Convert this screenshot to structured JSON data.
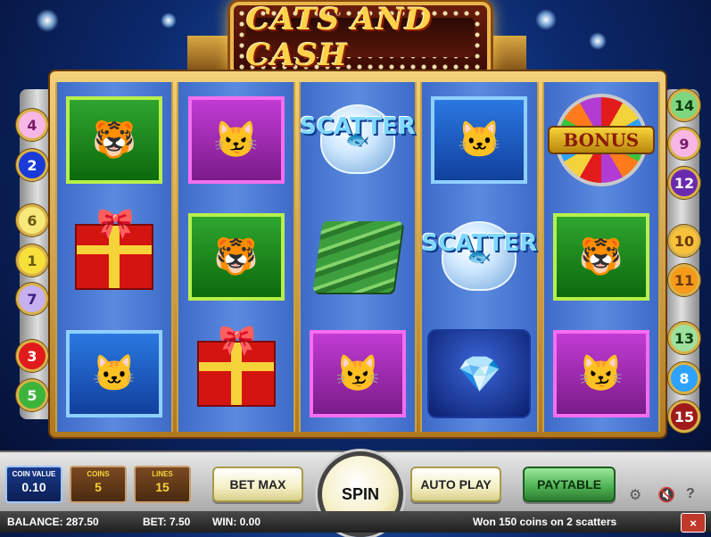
{
  "logo": {
    "text": "CATS AND CASH"
  },
  "reels": [
    [
      {
        "symbol": "tiger-cat",
        "frame": "green",
        "glyph": "🐯"
      },
      {
        "symbol": "gift",
        "frame": "none",
        "glyph": "🎀"
      },
      {
        "symbol": "lady-cat",
        "frame": "blue",
        "glyph": "🐱"
      }
    ],
    [
      {
        "symbol": "persian-cat",
        "frame": "purple",
        "glyph": "😼"
      },
      {
        "symbol": "tiger-cat",
        "frame": "green",
        "glyph": "🐯"
      },
      {
        "symbol": "gift",
        "frame": "none",
        "glyph": "🎀"
      }
    ],
    [
      {
        "symbol": "scatter",
        "label": "SCATTER",
        "glyph": "🐟"
      },
      {
        "symbol": "cash",
        "frame": "none",
        "glyph": "$"
      },
      {
        "symbol": "persian-cat",
        "frame": "purple",
        "glyph": "😼"
      }
    ],
    [
      {
        "symbol": "lady-cat",
        "frame": "blue",
        "glyph": "🐱"
      },
      {
        "symbol": "scatter",
        "label": "SCATTER",
        "glyph": "🐟"
      },
      {
        "symbol": "necklace",
        "frame": "none",
        "glyph": "💎"
      }
    ],
    [
      {
        "symbol": "bonus",
        "label": "BONUS"
      },
      {
        "symbol": "tiger-cat",
        "frame": "green",
        "glyph": "🐯"
      },
      {
        "symbol": "persian-cat",
        "frame": "purple",
        "glyph": "😼"
      }
    ]
  ],
  "left_lines": [
    {
      "num": "4",
      "bg": "#f7b7e6",
      "fg": "#7a1c6a"
    },
    {
      "num": "2",
      "bg": "#1a3ad8",
      "fg": "#ffffff"
    },
    {
      "num": "6",
      "bg": "#f7e87a",
      "fg": "#6a5a10"
    },
    {
      "num": "1",
      "bg": "#f7e03a",
      "fg": "#6a5a10"
    },
    {
      "num": "7",
      "bg": "#c7b0f0",
      "fg": "#3a1a7a"
    },
    {
      "num": "3",
      "bg": "#e11b1b",
      "fg": "#ffffff"
    },
    {
      "num": "5",
      "bg": "#3cb43c",
      "fg": "#ffffff"
    }
  ],
  "right_lines": [
    {
      "num": "14",
      "bg": "#7ed67e",
      "fg": "#0c3a0c"
    },
    {
      "num": "9",
      "bg": "#f7b7e6",
      "fg": "#7a1c6a"
    },
    {
      "num": "12",
      "bg": "#6a2ab0",
      "fg": "#ffffff"
    },
    {
      "num": "10",
      "bg": "#f7c23a",
      "fg": "#6a3a10"
    },
    {
      "num": "11",
      "bg": "#f79a1a",
      "fg": "#6a3a10"
    },
    {
      "num": "13",
      "bg": "#9ee09e",
      "fg": "#0c3a0c"
    },
    {
      "num": "8",
      "bg": "#2ea2ff",
      "fg": "#ffffff"
    },
    {
      "num": "15",
      "bg": "#a01a1a",
      "fg": "#ffffff"
    }
  ],
  "controls": {
    "coin_value_label": "COIN VALUE",
    "coin_value": "0.10",
    "coins_label": "COINS",
    "coins": "5",
    "lines_label": "LINES",
    "lines": "15",
    "bet_max": "BET MAX",
    "spin": "SPIN",
    "auto_play": "AUTO PLAY",
    "paytable": "PAYTABLE"
  },
  "status": {
    "balance": "BALANCE: 287.50",
    "bet": "BET: 7.50",
    "win": "WIN: 0.00",
    "message": "Won 150 coins on 2 scatters"
  }
}
